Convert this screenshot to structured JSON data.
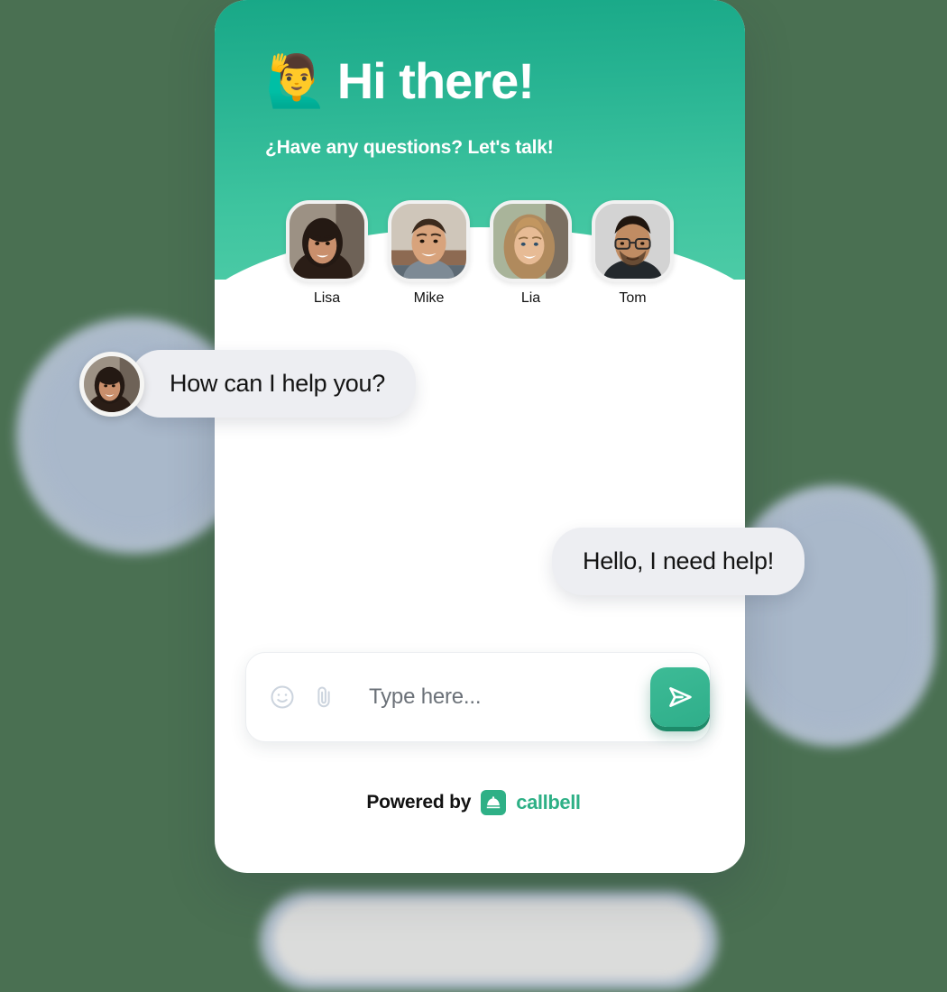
{
  "background": {
    "page_color": "#4a7052",
    "blob_color": "#b3c0d1"
  },
  "widget": {
    "header": {
      "emoji": "🙋‍♂️",
      "emoji_name": "person-raising-hand-emoji",
      "title": "Hi there!",
      "subtitle": "¿Have any questions? Let's talk!",
      "gradient_from": "#18a887",
      "gradient_to": "#4ccba6"
    },
    "agents": [
      {
        "name": "Lisa"
      },
      {
        "name": "Mike"
      },
      {
        "name": "Lia"
      },
      {
        "name": "Tom"
      }
    ],
    "messages": [
      {
        "from": "agent",
        "text": "How can I help you?",
        "avatar_name": "lisa-avatar"
      },
      {
        "from": "user",
        "text": "Hello, I need help!"
      }
    ],
    "composer": {
      "placeholder": "Type here...",
      "value": "",
      "emoji_button": "emoji-icon",
      "attach_button": "paperclip-icon",
      "send_button": "send-icon",
      "send_color": "#2fae8a"
    },
    "footer": {
      "powered_by": "Powered by",
      "brand": "callbell",
      "brand_color": "#2eb086",
      "logo_name": "callbell-logo-icon"
    }
  }
}
